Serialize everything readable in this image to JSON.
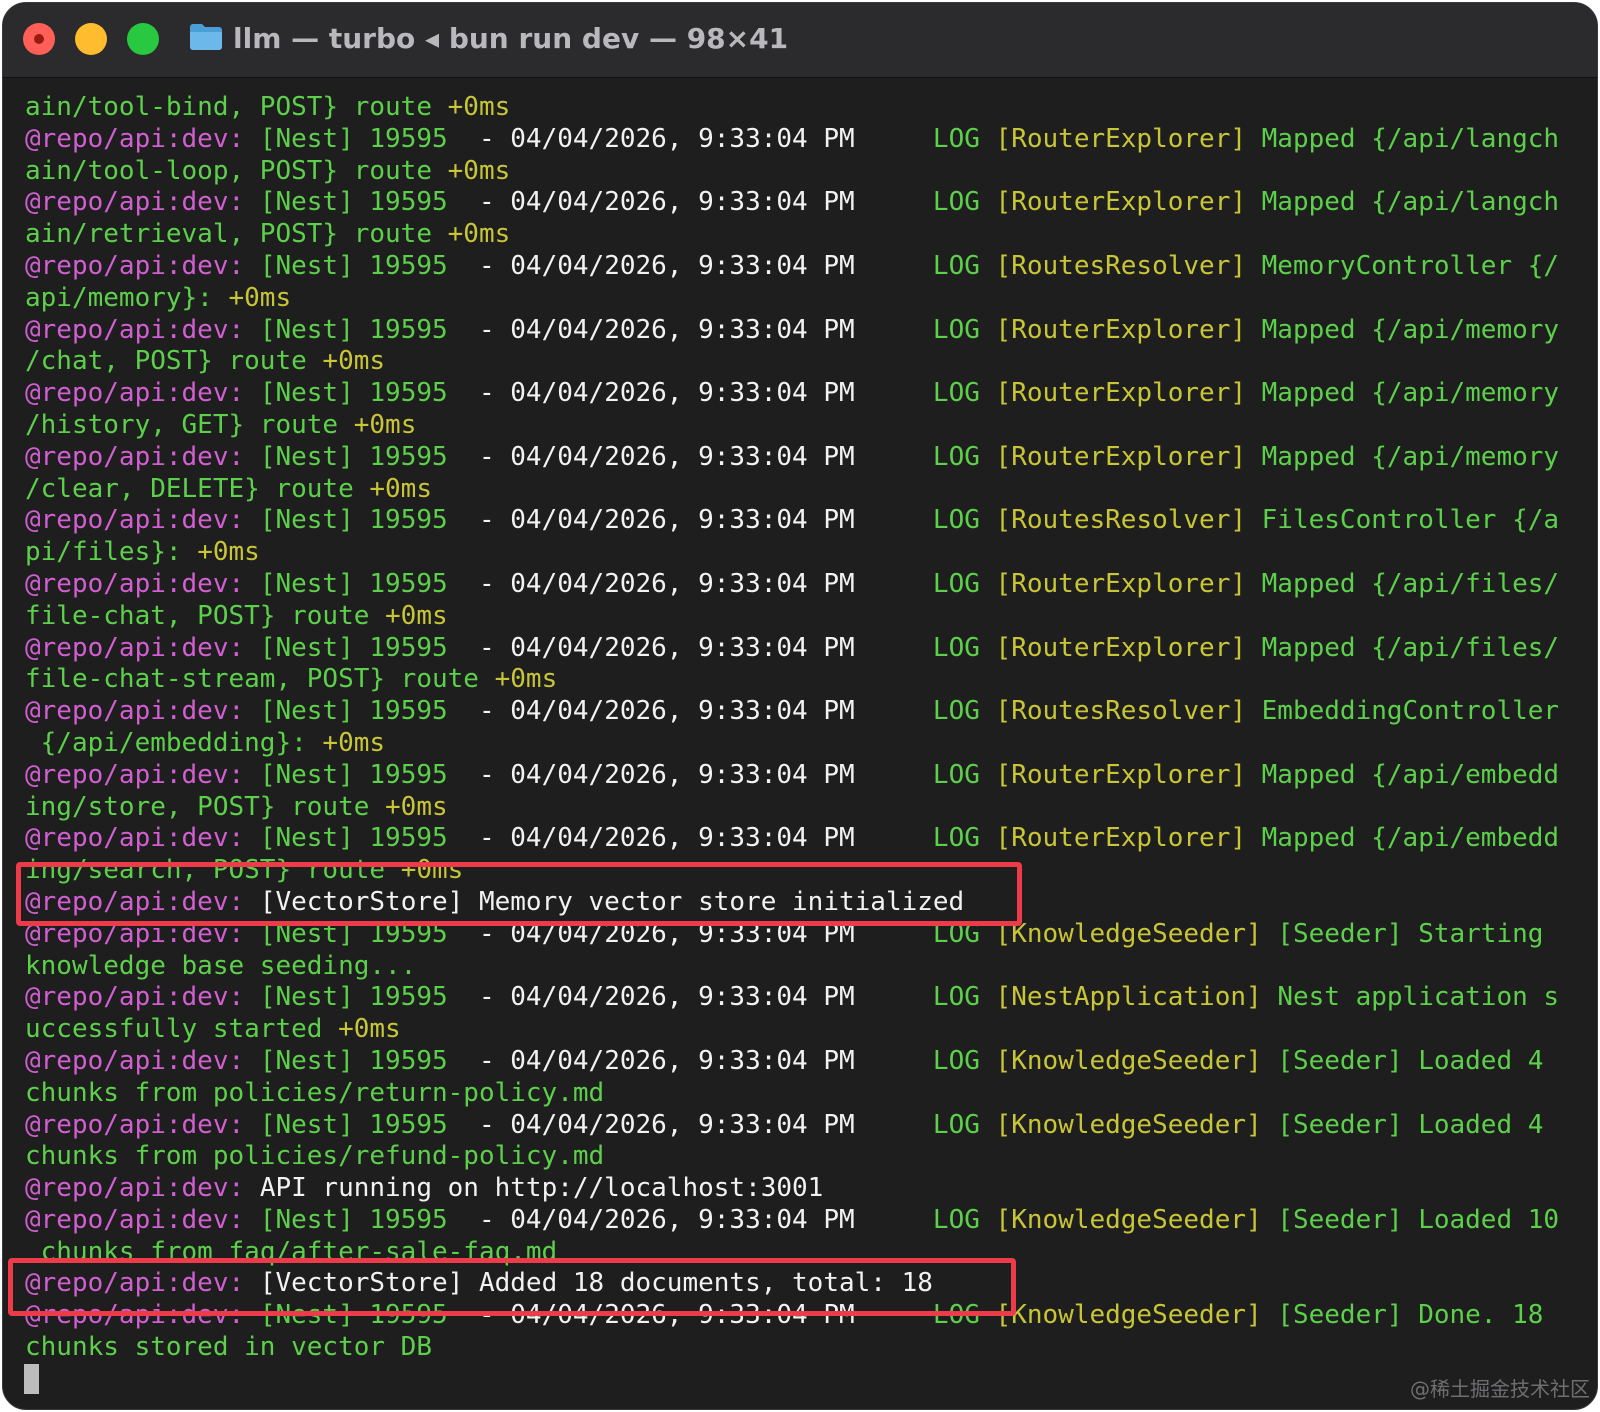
{
  "window": {
    "title": "llm — turbo ◂ bun run dev — 98×41",
    "accent_colors": {
      "prefix": "#d25fd2",
      "log": "#5dd04b",
      "context": "#c8c536",
      "highlight": "#ee3b4a"
    }
  },
  "terminal": {
    "lines": [
      {
        "segments": [
          {
            "t": "ain/tool-bind, POST} route ",
            "c": "g"
          },
          {
            "t": "+0ms",
            "c": "y"
          }
        ]
      },
      {
        "segments": [
          {
            "t": "@repo/api:dev: ",
            "c": "p"
          },
          {
            "t": "[Nest] 19595  ",
            "c": "g"
          },
          {
            "t": "- 04/04/2026, 9:33:04 PM",
            "c": "w"
          },
          {
            "t": "     LOG ",
            "c": "g"
          },
          {
            "t": "[RouterExplorer] ",
            "c": "y"
          },
          {
            "t": "Mapped {/api/langch",
            "c": "g"
          }
        ]
      },
      {
        "segments": [
          {
            "t": "ain/tool-loop, POST} route ",
            "c": "g"
          },
          {
            "t": "+0ms",
            "c": "y"
          }
        ]
      },
      {
        "segments": [
          {
            "t": "@repo/api:dev: ",
            "c": "p"
          },
          {
            "t": "[Nest] 19595  ",
            "c": "g"
          },
          {
            "t": "- 04/04/2026, 9:33:04 PM",
            "c": "w"
          },
          {
            "t": "     LOG ",
            "c": "g"
          },
          {
            "t": "[RouterExplorer] ",
            "c": "y"
          },
          {
            "t": "Mapped {/api/langch",
            "c": "g"
          }
        ]
      },
      {
        "segments": [
          {
            "t": "ain/retrieval, POST} route ",
            "c": "g"
          },
          {
            "t": "+0ms",
            "c": "y"
          }
        ]
      },
      {
        "segments": [
          {
            "t": "@repo/api:dev: ",
            "c": "p"
          },
          {
            "t": "[Nest] 19595  ",
            "c": "g"
          },
          {
            "t": "- 04/04/2026, 9:33:04 PM",
            "c": "w"
          },
          {
            "t": "     LOG ",
            "c": "g"
          },
          {
            "t": "[RoutesResolver] ",
            "c": "y"
          },
          {
            "t": "MemoryController {/",
            "c": "g"
          }
        ]
      },
      {
        "segments": [
          {
            "t": "api/memory}: ",
            "c": "g"
          },
          {
            "t": "+0ms",
            "c": "y"
          }
        ]
      },
      {
        "segments": [
          {
            "t": "@repo/api:dev: ",
            "c": "p"
          },
          {
            "t": "[Nest] 19595  ",
            "c": "g"
          },
          {
            "t": "- 04/04/2026, 9:33:04 PM",
            "c": "w"
          },
          {
            "t": "     LOG ",
            "c": "g"
          },
          {
            "t": "[RouterExplorer] ",
            "c": "y"
          },
          {
            "t": "Mapped {/api/memory",
            "c": "g"
          }
        ]
      },
      {
        "segments": [
          {
            "t": "/chat, POST} route ",
            "c": "g"
          },
          {
            "t": "+0ms",
            "c": "y"
          }
        ]
      },
      {
        "segments": [
          {
            "t": "@repo/api:dev: ",
            "c": "p"
          },
          {
            "t": "[Nest] 19595  ",
            "c": "g"
          },
          {
            "t": "- 04/04/2026, 9:33:04 PM",
            "c": "w"
          },
          {
            "t": "     LOG ",
            "c": "g"
          },
          {
            "t": "[RouterExplorer] ",
            "c": "y"
          },
          {
            "t": "Mapped {/api/memory",
            "c": "g"
          }
        ]
      },
      {
        "segments": [
          {
            "t": "/history, GET} route ",
            "c": "g"
          },
          {
            "t": "+0ms",
            "c": "y"
          }
        ]
      },
      {
        "segments": [
          {
            "t": "@repo/api:dev: ",
            "c": "p"
          },
          {
            "t": "[Nest] 19595  ",
            "c": "g"
          },
          {
            "t": "- 04/04/2026, 9:33:04 PM",
            "c": "w"
          },
          {
            "t": "     LOG ",
            "c": "g"
          },
          {
            "t": "[RouterExplorer] ",
            "c": "y"
          },
          {
            "t": "Mapped {/api/memory",
            "c": "g"
          }
        ]
      },
      {
        "segments": [
          {
            "t": "/clear, DELETE} route ",
            "c": "g"
          },
          {
            "t": "+0ms",
            "c": "y"
          }
        ]
      },
      {
        "segments": [
          {
            "t": "@repo/api:dev: ",
            "c": "p"
          },
          {
            "t": "[Nest] 19595  ",
            "c": "g"
          },
          {
            "t": "- 04/04/2026, 9:33:04 PM",
            "c": "w"
          },
          {
            "t": "     LOG ",
            "c": "g"
          },
          {
            "t": "[RoutesResolver] ",
            "c": "y"
          },
          {
            "t": "FilesController {/a",
            "c": "g"
          }
        ]
      },
      {
        "segments": [
          {
            "t": "pi/files}: ",
            "c": "g"
          },
          {
            "t": "+0ms",
            "c": "y"
          }
        ]
      },
      {
        "segments": [
          {
            "t": "@repo/api:dev: ",
            "c": "p"
          },
          {
            "t": "[Nest] 19595  ",
            "c": "g"
          },
          {
            "t": "- 04/04/2026, 9:33:04 PM",
            "c": "w"
          },
          {
            "t": "     LOG ",
            "c": "g"
          },
          {
            "t": "[RouterExplorer] ",
            "c": "y"
          },
          {
            "t": "Mapped {/api/files/",
            "c": "g"
          }
        ]
      },
      {
        "segments": [
          {
            "t": "file-chat, POST} route ",
            "c": "g"
          },
          {
            "t": "+0ms",
            "c": "y"
          }
        ]
      },
      {
        "segments": [
          {
            "t": "@repo/api:dev: ",
            "c": "p"
          },
          {
            "t": "[Nest] 19595  ",
            "c": "g"
          },
          {
            "t": "- 04/04/2026, 9:33:04 PM",
            "c": "w"
          },
          {
            "t": "     LOG ",
            "c": "g"
          },
          {
            "t": "[RouterExplorer] ",
            "c": "y"
          },
          {
            "t": "Mapped {/api/files/",
            "c": "g"
          }
        ]
      },
      {
        "segments": [
          {
            "t": "file-chat-stream, POST} route ",
            "c": "g"
          },
          {
            "t": "+0ms",
            "c": "y"
          }
        ]
      },
      {
        "segments": [
          {
            "t": "@repo/api:dev: ",
            "c": "p"
          },
          {
            "t": "[Nest] 19595  ",
            "c": "g"
          },
          {
            "t": "- 04/04/2026, 9:33:04 PM",
            "c": "w"
          },
          {
            "t": "     LOG ",
            "c": "g"
          },
          {
            "t": "[RoutesResolver] ",
            "c": "y"
          },
          {
            "t": "EmbeddingController",
            "c": "g"
          }
        ]
      },
      {
        "segments": [
          {
            "t": " {/api/embedding}: ",
            "c": "g"
          },
          {
            "t": "+0ms",
            "c": "y"
          }
        ]
      },
      {
        "segments": [
          {
            "t": "@repo/api:dev: ",
            "c": "p"
          },
          {
            "t": "[Nest] 19595  ",
            "c": "g"
          },
          {
            "t": "- 04/04/2026, 9:33:04 PM",
            "c": "w"
          },
          {
            "t": "     LOG ",
            "c": "g"
          },
          {
            "t": "[RouterExplorer] ",
            "c": "y"
          },
          {
            "t": "Mapped {/api/embedd",
            "c": "g"
          }
        ]
      },
      {
        "segments": [
          {
            "t": "ing/store, POST} route ",
            "c": "g"
          },
          {
            "t": "+0ms",
            "c": "y"
          }
        ]
      },
      {
        "segments": [
          {
            "t": "@repo/api:dev: ",
            "c": "p"
          },
          {
            "t": "[Nest] 19595  ",
            "c": "g"
          },
          {
            "t": "- 04/04/2026, 9:33:04 PM",
            "c": "w"
          },
          {
            "t": "     LOG ",
            "c": "g"
          },
          {
            "t": "[RouterExplorer] ",
            "c": "y"
          },
          {
            "t": "Mapped {/api/embedd",
            "c": "g"
          }
        ]
      },
      {
        "segments": [
          {
            "t": "ing/search, POST} route ",
            "c": "g"
          },
          {
            "t": "+0ms",
            "c": "y"
          }
        ]
      },
      {
        "segments": [
          {
            "t": "@repo/api:dev: ",
            "c": "p"
          },
          {
            "t": "[VectorStore] Memory vector store initialized",
            "c": "w"
          }
        ]
      },
      {
        "segments": [
          {
            "t": "@repo/api:dev: ",
            "c": "p"
          },
          {
            "t": "[Nest] 19595  ",
            "c": "g"
          },
          {
            "t": "- 04/04/2026, 9:33:04 PM",
            "c": "w"
          },
          {
            "t": "     LOG ",
            "c": "g"
          },
          {
            "t": "[KnowledgeSeeder] ",
            "c": "y"
          },
          {
            "t": "[Seeder] Starting",
            "c": "g"
          }
        ]
      },
      {
        "segments": [
          {
            "t": "knowledge base seeding...",
            "c": "g"
          }
        ]
      },
      {
        "segments": [
          {
            "t": "@repo/api:dev: ",
            "c": "p"
          },
          {
            "t": "[Nest] 19595  ",
            "c": "g"
          },
          {
            "t": "- 04/04/2026, 9:33:04 PM",
            "c": "w"
          },
          {
            "t": "     LOG ",
            "c": "g"
          },
          {
            "t": "[NestApplication] ",
            "c": "y"
          },
          {
            "t": "Nest application s",
            "c": "g"
          }
        ]
      },
      {
        "segments": [
          {
            "t": "uccessfully started ",
            "c": "g"
          },
          {
            "t": "+0ms",
            "c": "y"
          }
        ]
      },
      {
        "segments": [
          {
            "t": "@repo/api:dev: ",
            "c": "p"
          },
          {
            "t": "[Nest] 19595  ",
            "c": "g"
          },
          {
            "t": "- 04/04/2026, 9:33:04 PM",
            "c": "w"
          },
          {
            "t": "     LOG ",
            "c": "g"
          },
          {
            "t": "[KnowledgeSeeder] ",
            "c": "y"
          },
          {
            "t": "[Seeder] Loaded 4",
            "c": "g"
          }
        ]
      },
      {
        "segments": [
          {
            "t": "chunks from policies/return-policy.md",
            "c": "g"
          }
        ]
      },
      {
        "segments": [
          {
            "t": "@repo/api:dev: ",
            "c": "p"
          },
          {
            "t": "[Nest] 19595  ",
            "c": "g"
          },
          {
            "t": "- 04/04/2026, 9:33:04 PM",
            "c": "w"
          },
          {
            "t": "     LOG ",
            "c": "g"
          },
          {
            "t": "[KnowledgeSeeder] ",
            "c": "y"
          },
          {
            "t": "[Seeder] Loaded 4",
            "c": "g"
          }
        ]
      },
      {
        "segments": [
          {
            "t": "chunks from policies/refund-policy.md",
            "c": "g"
          }
        ]
      },
      {
        "segments": [
          {
            "t": "@repo/api:dev: ",
            "c": "p"
          },
          {
            "t": "API running on http://localhost:3001",
            "c": "w"
          }
        ]
      },
      {
        "segments": [
          {
            "t": "@repo/api:dev: ",
            "c": "p"
          },
          {
            "t": "[Nest] 19595  ",
            "c": "g"
          },
          {
            "t": "- 04/04/2026, 9:33:04 PM",
            "c": "w"
          },
          {
            "t": "     LOG ",
            "c": "g"
          },
          {
            "t": "[KnowledgeSeeder] ",
            "c": "y"
          },
          {
            "t": "[Seeder] Loaded 10",
            "c": "g"
          }
        ]
      },
      {
        "segments": [
          {
            "t": " chunks from faq/after-sale-faq.md",
            "c": "g"
          }
        ]
      },
      {
        "segments": [
          {
            "t": "@repo/api:dev: ",
            "c": "p"
          },
          {
            "t": "[VectorStore] Added 18 documents, total: 18",
            "c": "w"
          }
        ]
      },
      {
        "segments": [
          {
            "t": "@repo/api:dev: ",
            "c": "p"
          },
          {
            "t": "[Nest] 19595  ",
            "c": "g"
          },
          {
            "t": "- 04/04/2026, 9:33:04 PM",
            "c": "w"
          },
          {
            "t": "     LOG ",
            "c": "g"
          },
          {
            "t": "[KnowledgeSeeder] ",
            "c": "y"
          },
          {
            "t": "[Seeder] Done. 18",
            "c": "g"
          }
        ]
      },
      {
        "segments": [
          {
            "t": "chunks stored in vector DB",
            "c": "g"
          }
        ]
      }
    ]
  },
  "watermark": "@稀土掘金技术社区"
}
